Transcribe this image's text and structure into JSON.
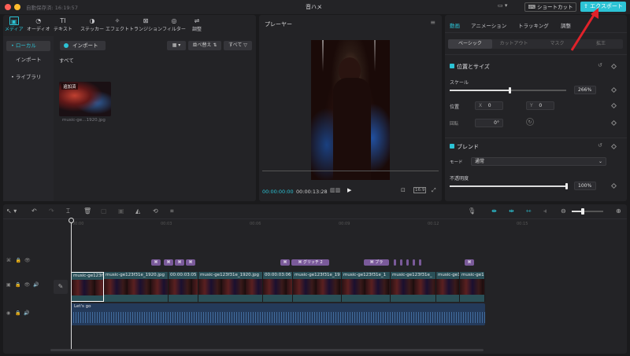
{
  "window": {
    "autosave": "自動保存済: 16:19:57",
    "title": "音ハメ",
    "shortcut_label": "ショートカット",
    "export_label": "エクスポート"
  },
  "media_toolbar": [
    {
      "icon": "media-icon",
      "glyph": "▣",
      "label": "メディア"
    },
    {
      "icon": "audio-icon",
      "glyph": "◔",
      "label": "オーディオ"
    },
    {
      "icon": "text-icon",
      "glyph": "TI",
      "label": "テキスト"
    },
    {
      "icon": "sticker-icon",
      "glyph": "◑",
      "label": "ステッカー"
    },
    {
      "icon": "effect-icon",
      "glyph": "✧",
      "label": "エフェクト"
    },
    {
      "icon": "transition-icon",
      "glyph": "⊠",
      "label": "トランジション"
    },
    {
      "icon": "filter-icon",
      "glyph": "◎",
      "label": "フィルター"
    },
    {
      "icon": "adjust-icon",
      "glyph": "⇌",
      "label": "調整"
    }
  ],
  "media_sidebar": [
    {
      "label": "• ローカル"
    },
    {
      "label": "インポート"
    },
    {
      "label": "• ライブラリ"
    }
  ],
  "media": {
    "import_label": "インポート",
    "sort_label": "並べ替え ⇅",
    "filter_label": "すべて ▽",
    "all_label": "すべて",
    "thumb_tag": "追加済",
    "thumb_name": "music-ge…1920.jpg"
  },
  "player": {
    "title": "プレーヤー",
    "current_time": "00:00:00:00",
    "total_time": "00:00:13:28"
  },
  "props": {
    "tabs": [
      "動画",
      "アニメーション",
      "トラッキング",
      "調整"
    ],
    "subtabs": [
      "ベーシック",
      "カットアウト",
      "マスク",
      "拡王"
    ],
    "position_size": "位置とサイズ",
    "scale_label": "スケール",
    "scale_value": "266%",
    "scale_fraction": 0.52,
    "pos_label": "位置",
    "x_label": "X",
    "x_value": "0",
    "y_label": "Y",
    "y_value": "0",
    "rotate_label": "回転",
    "rotate_value": "0°",
    "blend_label": "ブレンド",
    "mode_label": "モード",
    "mode_value": "通常",
    "opacity_label": "不透明度",
    "opacity_value": "100%",
    "opacity_fraction": 1.0
  },
  "timeline": {
    "ruler": [
      "00:00",
      "00:03",
      "00:06",
      "00:09",
      "00:12",
      "00:15"
    ],
    "fx_labels": [
      "",
      "",
      "",
      "",
      "",
      "グリッチ 2",
      "",
      "ブラ",
      ""
    ],
    "clips": [
      {
        "name": "music-ge123f"
      },
      {
        "name": "music-ge123f31e_1920.jpg"
      },
      {
        "name": "00:00:03:05"
      },
      {
        "name": "music-ge123f31e_1920.jpg"
      },
      {
        "name": "00:00:03:06"
      },
      {
        "name": "music-ge123f31e_19"
      },
      {
        "name": "music-ge123f31e_1"
      },
      {
        "name": "music-ge123f31e_"
      },
      {
        "name": "music-ge123f31e_"
      },
      {
        "name": "music-ge123f31e_19"
      }
    ],
    "audio_name": "Let's go"
  }
}
